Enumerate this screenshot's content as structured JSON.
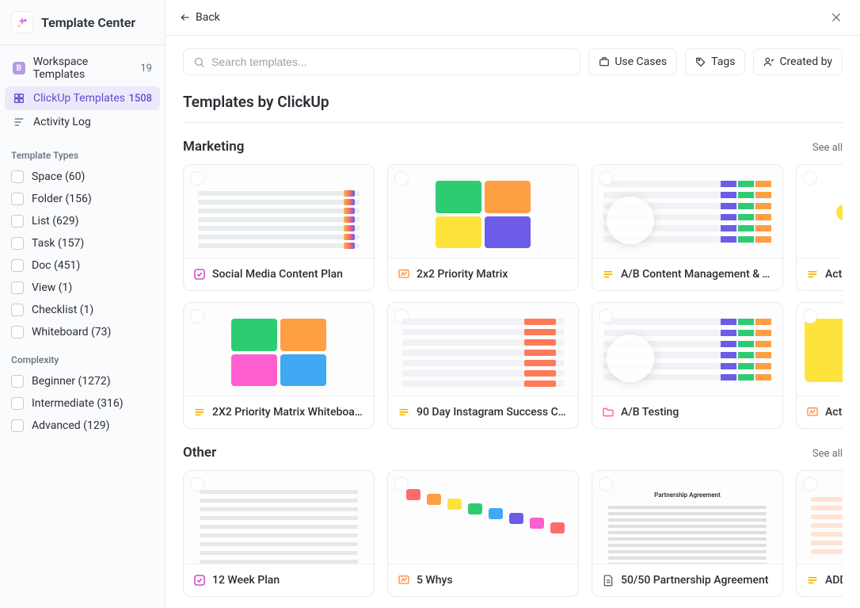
{
  "app": {
    "title": "Template Center"
  },
  "nav": {
    "workspace_badge": "B",
    "items": [
      {
        "label": "Workspace Templates",
        "count": "19"
      },
      {
        "label": "ClickUp Templates",
        "count": "1508"
      },
      {
        "label": "Activity Log",
        "count": ""
      }
    ]
  },
  "filters": {
    "types_heading": "Template Types",
    "types": [
      {
        "label": "Space (60)"
      },
      {
        "label": "Folder (156)"
      },
      {
        "label": "List (629)"
      },
      {
        "label": "Task (157)"
      },
      {
        "label": "Doc (451)"
      },
      {
        "label": "View (1)"
      },
      {
        "label": "Checklist (1)"
      },
      {
        "label": "Whiteboard (73)"
      }
    ],
    "complexity_heading": "Complexity",
    "complexity": [
      {
        "label": "Beginner (1272)"
      },
      {
        "label": "Intermediate (316)"
      },
      {
        "label": "Advanced (129)"
      }
    ]
  },
  "header": {
    "back": "Back"
  },
  "toolbar": {
    "search_placeholder": "Search templates...",
    "use_cases": "Use Cases",
    "tags": "Tags",
    "created_by": "Created by"
  },
  "page": {
    "title": "Templates by ClickUp"
  },
  "sections": [
    {
      "title": "Marketing",
      "see_all": "See all",
      "rows": [
        [
          {
            "title": "Social Media Content Plan",
            "icon": "task",
            "thumb": "list"
          },
          {
            "title": "2x2 Priority Matrix",
            "icon": "whiteboard",
            "thumb": "matrix"
          },
          {
            "title": "A/B Content Management & T…",
            "icon": "list",
            "thumb": "ab-bubble"
          },
          {
            "title": "Action P…",
            "icon": "list",
            "thumb": "mind"
          }
        ],
        [
          {
            "title": "2X2 Priority Matrix Whiteboard",
            "icon": "list",
            "thumb": "matrix2"
          },
          {
            "title": "90 Day Instagram Success Ch…",
            "icon": "list",
            "thumb": "gantt"
          },
          {
            "title": "A/B Testing",
            "icon": "folder",
            "thumb": "ab-bubble"
          },
          {
            "title": "Action P…",
            "icon": "whiteboard",
            "thumb": "mind2"
          }
        ]
      ]
    },
    {
      "title": "Other",
      "see_all": "See all",
      "rows": [
        [
          {
            "title": "12 Week Plan",
            "icon": "task",
            "thumb": "checklist"
          },
          {
            "title": "5 Whys",
            "icon": "whiteboard",
            "thumb": "steps"
          },
          {
            "title": "50/50 Partnership Agreement",
            "icon": "doc",
            "thumb": "doc"
          },
          {
            "title": "ADDIE",
            "icon": "list",
            "thumb": "list2"
          }
        ]
      ]
    }
  ]
}
